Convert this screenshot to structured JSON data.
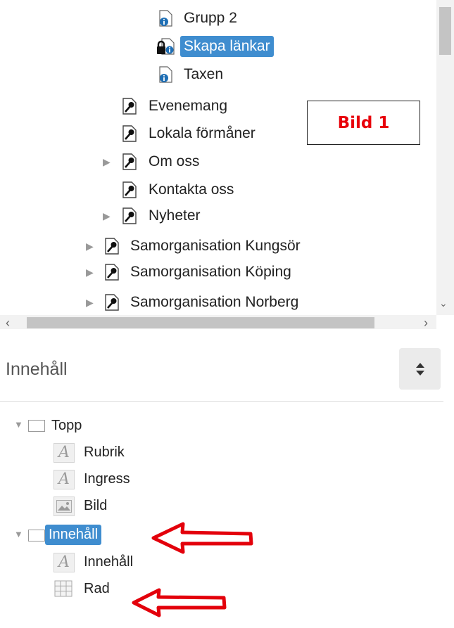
{
  "page_tree": {
    "items": [
      {
        "label": "Grupp 2",
        "icon": "info-page-icon",
        "selected": false,
        "expander": false
      },
      {
        "label": "Skapa länkar",
        "icon": "lock-page-icon",
        "selected": true,
        "expander": false
      },
      {
        "label": "Taxen",
        "icon": "info-page-icon",
        "selected": false,
        "expander": false
      },
      {
        "label": "Evenemang",
        "icon": "page-icon",
        "selected": false,
        "expander": false
      },
      {
        "label": "Lokala förmåner",
        "icon": "page-icon",
        "selected": false,
        "expander": false
      },
      {
        "label": "Om oss",
        "icon": "page-icon",
        "selected": false,
        "expander": true
      },
      {
        "label": "Kontakta oss",
        "icon": "page-icon",
        "selected": false,
        "expander": false
      },
      {
        "label": "Nyheter",
        "icon": "page-icon",
        "selected": false,
        "expander": true
      },
      {
        "label": "Samorganisation Kungsör",
        "icon": "page-icon",
        "selected": false,
        "expander": true
      },
      {
        "label": "Samorganisation Köping",
        "icon": "page-icon",
        "selected": false,
        "expander": true
      },
      {
        "label": "Samorganisation Norberg",
        "icon": "page-icon",
        "selected": false,
        "expander": true
      }
    ],
    "annotation": "Bild 1",
    "annotation_color": "#e8000b",
    "selected_color": "#3f8dcf"
  },
  "content_panel": {
    "title": "Innehåll",
    "sort_icon": "sort-icon",
    "items": [
      {
        "label": "Topp",
        "icon": "container-icon",
        "expanded": true,
        "selected": false
      },
      {
        "label": "Rubrik",
        "icon": "text-icon",
        "selected": false
      },
      {
        "label": "Ingress",
        "icon": "text-icon",
        "selected": false
      },
      {
        "label": "Bild",
        "icon": "image-icon",
        "selected": false
      },
      {
        "label": "Innehåll",
        "icon": "container-icon",
        "expanded": true,
        "selected": true
      },
      {
        "label": "Innehåll",
        "icon": "text-icon",
        "selected": false
      },
      {
        "label": "Rad",
        "icon": "grid-icon",
        "selected": false
      }
    ]
  }
}
